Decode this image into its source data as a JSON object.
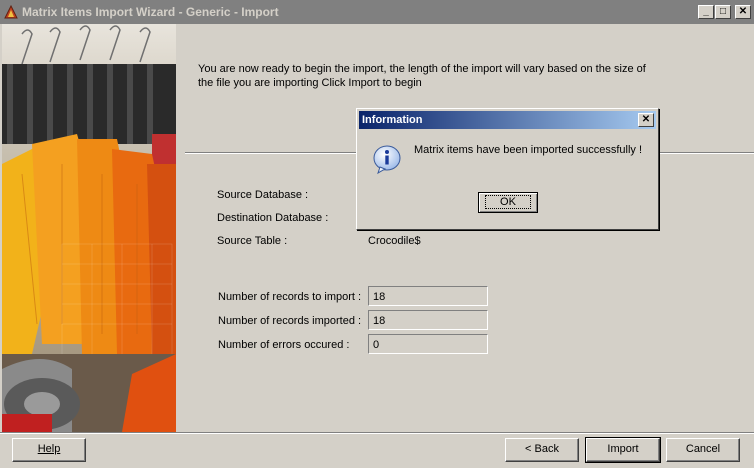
{
  "window": {
    "title": "Matrix Items Import Wizard - Generic - Import",
    "controls": {
      "minimize": "_",
      "maximize": "□",
      "close": "✕"
    }
  },
  "intro_text": "You are now ready to begin the import, the length of the import will vary based on the size of the file you are importing Click Import to begin",
  "fields": {
    "source_database_label": "Source Database :",
    "destination_database_label": "Destination Database :",
    "source_table_label": "Source Table :",
    "source_table_value": "Crocodile$"
  },
  "stats": {
    "records_to_import_label": "Number of records to import :",
    "records_to_import_value": "18",
    "records_imported_label": "Number of records imported :",
    "records_imported_value": "18",
    "errors_label": "Number of errors occured :",
    "errors_value": "0"
  },
  "buttons": {
    "help": "Help",
    "back": "< Back",
    "import": "Import",
    "cancel": "Cancel"
  },
  "dialog": {
    "title": "Information",
    "close": "✕",
    "message": "Matrix items have been imported successfully  !",
    "ok": "OK"
  }
}
